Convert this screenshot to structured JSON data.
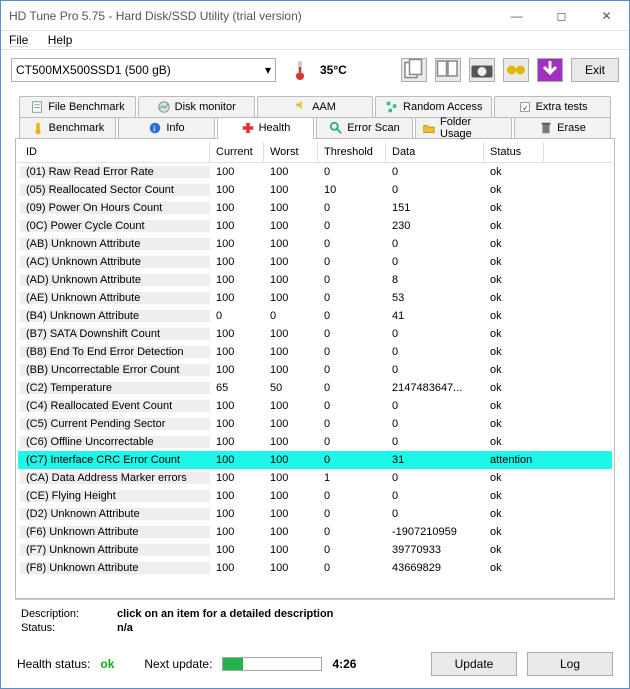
{
  "window": {
    "title": "HD Tune Pro 5.75 - Hard Disk/SSD Utility (trial version)"
  },
  "menu": {
    "file": "File",
    "help": "Help"
  },
  "toolbar": {
    "drive": "CT500MX500SSD1 (500 gB)",
    "temperature": "35°C",
    "exit": "Exit"
  },
  "tabs": {
    "row1": [
      {
        "icon": "file-benchmark",
        "label": "File Benchmark"
      },
      {
        "icon": "disk-monitor",
        "label": "Disk monitor"
      },
      {
        "icon": "aam",
        "label": "AAM"
      },
      {
        "icon": "random-access",
        "label": "Random Access"
      },
      {
        "icon": "extra-tests",
        "label": "Extra tests"
      }
    ],
    "row2": [
      {
        "icon": "benchmark",
        "label": "Benchmark"
      },
      {
        "icon": "info",
        "label": "Info"
      },
      {
        "icon": "health",
        "label": "Health",
        "active": true
      },
      {
        "icon": "error-scan",
        "label": "Error Scan"
      },
      {
        "icon": "folder-usage",
        "label": "Folder Usage"
      },
      {
        "icon": "erase",
        "label": "Erase"
      }
    ]
  },
  "columns": [
    "ID",
    "Current",
    "Worst",
    "Threshold",
    "Data",
    "Status"
  ],
  "rows": [
    {
      "id": "(01) Raw Read Error Rate",
      "cur": "100",
      "wst": "100",
      "th": "0",
      "data": "0",
      "st": "ok"
    },
    {
      "id": "(05) Reallocated Sector Count",
      "cur": "100",
      "wst": "100",
      "th": "10",
      "data": "0",
      "st": "ok"
    },
    {
      "id": "(09) Power On Hours Count",
      "cur": "100",
      "wst": "100",
      "th": "0",
      "data": "151",
      "st": "ok"
    },
    {
      "id": "(0C) Power Cycle Count",
      "cur": "100",
      "wst": "100",
      "th": "0",
      "data": "230",
      "st": "ok"
    },
    {
      "id": "(AB) Unknown Attribute",
      "cur": "100",
      "wst": "100",
      "th": "0",
      "data": "0",
      "st": "ok"
    },
    {
      "id": "(AC) Unknown Attribute",
      "cur": "100",
      "wst": "100",
      "th": "0",
      "data": "0",
      "st": "ok"
    },
    {
      "id": "(AD) Unknown Attribute",
      "cur": "100",
      "wst": "100",
      "th": "0",
      "data": "8",
      "st": "ok"
    },
    {
      "id": "(AE) Unknown Attribute",
      "cur": "100",
      "wst": "100",
      "th": "0",
      "data": "53",
      "st": "ok"
    },
    {
      "id": "(B4) Unknown Attribute",
      "cur": "0",
      "wst": "0",
      "th": "0",
      "data": "41",
      "st": "ok"
    },
    {
      "id": "(B7) SATA Downshift Count",
      "cur": "100",
      "wst": "100",
      "th": "0",
      "data": "0",
      "st": "ok"
    },
    {
      "id": "(B8) End To End Error Detection",
      "cur": "100",
      "wst": "100",
      "th": "0",
      "data": "0",
      "st": "ok"
    },
    {
      "id": "(BB) Uncorrectable Error Count",
      "cur": "100",
      "wst": "100",
      "th": "0",
      "data": "0",
      "st": "ok"
    },
    {
      "id": "(C2) Temperature",
      "cur": "65",
      "wst": "50",
      "th": "0",
      "data": "2147483647...",
      "st": "ok"
    },
    {
      "id": "(C4) Reallocated Event Count",
      "cur": "100",
      "wst": "100",
      "th": "0",
      "data": "0",
      "st": "ok"
    },
    {
      "id": "(C5) Current Pending Sector",
      "cur": "100",
      "wst": "100",
      "th": "0",
      "data": "0",
      "st": "ok"
    },
    {
      "id": "(C6) Offline Uncorrectable",
      "cur": "100",
      "wst": "100",
      "th": "0",
      "data": "0",
      "st": "ok"
    },
    {
      "id": "(C7) Interface CRC Error Count",
      "cur": "100",
      "wst": "100",
      "th": "0",
      "data": "31",
      "st": "attention",
      "hl": true
    },
    {
      "id": "(CA) Data Address Marker errors",
      "cur": "100",
      "wst": "100",
      "th": "1",
      "data": "0",
      "st": "ok"
    },
    {
      "id": "(CE) Flying Height",
      "cur": "100",
      "wst": "100",
      "th": "0",
      "data": "0",
      "st": "ok"
    },
    {
      "id": "(D2) Unknown Attribute",
      "cur": "100",
      "wst": "100",
      "th": "0",
      "data": "0",
      "st": "ok"
    },
    {
      "id": "(F6) Unknown Attribute",
      "cur": "100",
      "wst": "100",
      "th": "0",
      "data": "-1907210959",
      "st": "ok"
    },
    {
      "id": "(F7) Unknown Attribute",
      "cur": "100",
      "wst": "100",
      "th": "0",
      "data": "39770933",
      "st": "ok"
    },
    {
      "id": "(F8) Unknown Attribute",
      "cur": "100",
      "wst": "100",
      "th": "0",
      "data": "43669829",
      "st": "ok"
    }
  ],
  "details": {
    "desc_label": "Description:",
    "desc_value": "click on an item for a detailed description",
    "status_label": "Status:",
    "status_value": "n/a"
  },
  "footer": {
    "health_label": "Health status:",
    "health_value": "ok",
    "next_update_label": "Next update:",
    "countdown": "4:26",
    "update_btn": "Update",
    "log_btn": "Log"
  }
}
